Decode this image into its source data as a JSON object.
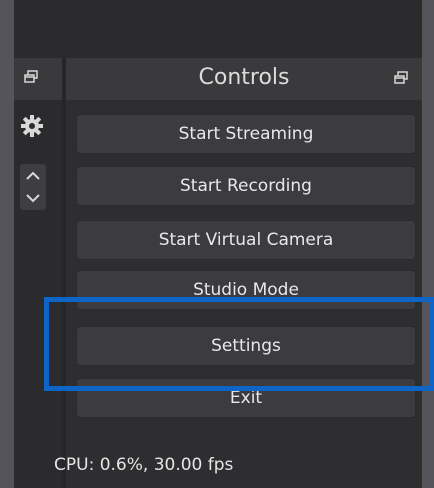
{
  "controls": {
    "title": "Controls",
    "buttons": [
      "Start Streaming",
      "Start Recording",
      "Start Virtual Camera",
      "Studio Mode",
      "Settings",
      "Exit"
    ]
  },
  "status": {
    "text": "CPU: 0.6%, 30.00 fps"
  },
  "icons": [
    "float-icon",
    "gear-icon",
    "chevron-up-icon",
    "chevron-down-icon"
  ],
  "colors": {
    "highlight": "#0f64c8",
    "button": "#3c3c40",
    "panel_header": "#3a3a3d"
  }
}
